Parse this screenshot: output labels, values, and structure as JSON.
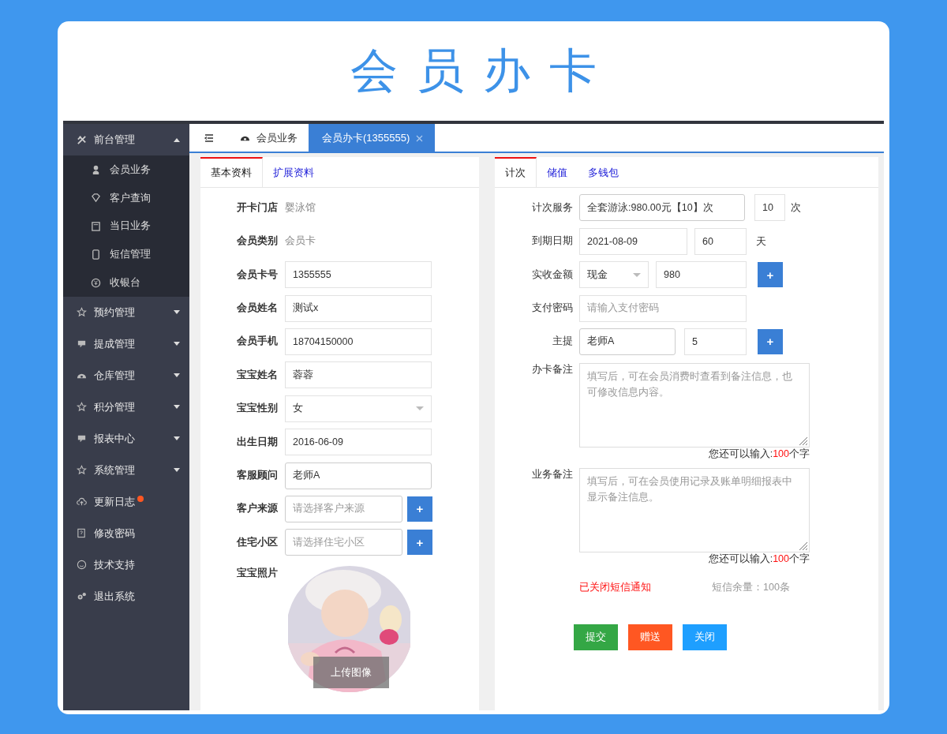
{
  "banner_title": "会员办卡",
  "sidebar": {
    "items": [
      {
        "label": "前台管理",
        "expanded": true,
        "children": [
          {
            "label": "会员业务"
          },
          {
            "label": "客户查询"
          },
          {
            "label": "当日业务"
          },
          {
            "label": "短信管理"
          },
          {
            "label": "收银台"
          }
        ]
      },
      {
        "label": "预约管理",
        "expanded": false
      },
      {
        "label": "提成管理",
        "expanded": false
      },
      {
        "label": "仓库管理",
        "expanded": false
      },
      {
        "label": "积分管理",
        "expanded": false
      },
      {
        "label": "报表中心",
        "expanded": false
      },
      {
        "label": "系统管理",
        "expanded": false
      },
      {
        "label": "更新日志",
        "notice": true
      },
      {
        "label": "修改密码"
      },
      {
        "label": "技术支持"
      },
      {
        "label": "退出系统"
      }
    ]
  },
  "tabs": [
    {
      "label": "会员业务",
      "selected": false,
      "closable": false
    },
    {
      "label": "会员办卡(1355555)",
      "selected": true,
      "closable": true
    }
  ],
  "left_panel": {
    "tabs": [
      {
        "label": "基本资料",
        "selected": true
      },
      {
        "label": "扩展资料",
        "selected": false
      }
    ],
    "fields": [
      {
        "kind": "text",
        "label": "开卡门店",
        "value": "婴泳馆"
      },
      {
        "kind": "text",
        "label": "会员类别",
        "value": "会员卡"
      },
      {
        "kind": "input",
        "label": "会员卡号",
        "value": "1355555"
      },
      {
        "kind": "input",
        "label": "会员姓名",
        "value": "测试x"
      },
      {
        "kind": "input",
        "label": "会员手机",
        "value": "18704150000"
      },
      {
        "kind": "input",
        "label": "宝宝姓名",
        "value": "蓉蓉"
      },
      {
        "kind": "select",
        "label": "宝宝性别",
        "value": "女"
      },
      {
        "kind": "input",
        "label": "出生日期",
        "value": "2016-06-09"
      },
      {
        "kind": "input",
        "label": "客服顾问",
        "value": "老师A"
      },
      {
        "kind": "input_add",
        "label": "客户来源",
        "placeholder": "请选择客户来源",
        "add": "+"
      },
      {
        "kind": "input_add",
        "label": "住宅小区",
        "placeholder": "请选择住宅小区",
        "add": "+"
      },
      {
        "label": "宝宝照片",
        "button": "上传图像"
      }
    ]
  },
  "right_panel": {
    "tabs": [
      {
        "label": "计次",
        "selected": true
      },
      {
        "label": "储值",
        "selected": false
      },
      {
        "label": "多钱包",
        "selected": false
      }
    ],
    "fields": [
      {
        "kind": "service",
        "label": "计次服务",
        "value": "全套游泳:980.00元【10】次",
        "count": "10",
        "unit": "次"
      },
      {
        "kind": "expiry",
        "label": "到期日期",
        "value": "2021-08-09",
        "days": "60",
        "unit": "天"
      },
      {
        "kind": "payment",
        "label": "实收金额",
        "method": "现金",
        "amount": "980",
        "add": "+"
      },
      {
        "kind": "input",
        "label": "支付密码",
        "placeholder": "请输入支付密码"
      },
      {
        "kind": "staff",
        "label": "主提",
        "value": "老师A",
        "share": "5",
        "add": "+"
      },
      {
        "kind": "textarea",
        "label": "办卡备注",
        "placeholder": "填写后，可在会员消费时查看到备注信息，也可修改信息内容。",
        "counter_prefix": "您还可以输入:",
        "counter_value": "100",
        "counter_suffix": "个字"
      },
      {
        "kind": "textarea",
        "label": "业务备注",
        "placeholder": "填写后，可在会员使用记录及账单明细报表中显示备注信息。",
        "counter_prefix": "您还可以输入:",
        "counter_value": "100",
        "counter_suffix": "个字"
      }
    ],
    "sms_status": "已关闭短信通知",
    "sms_balance": "短信余量：100条",
    "buttons": [
      {
        "label": "提交",
        "color": "#34a745"
      },
      {
        "label": "赠送",
        "color": "#ff5722"
      },
      {
        "label": "关闭",
        "color": "#1e9fff"
      }
    ]
  }
}
